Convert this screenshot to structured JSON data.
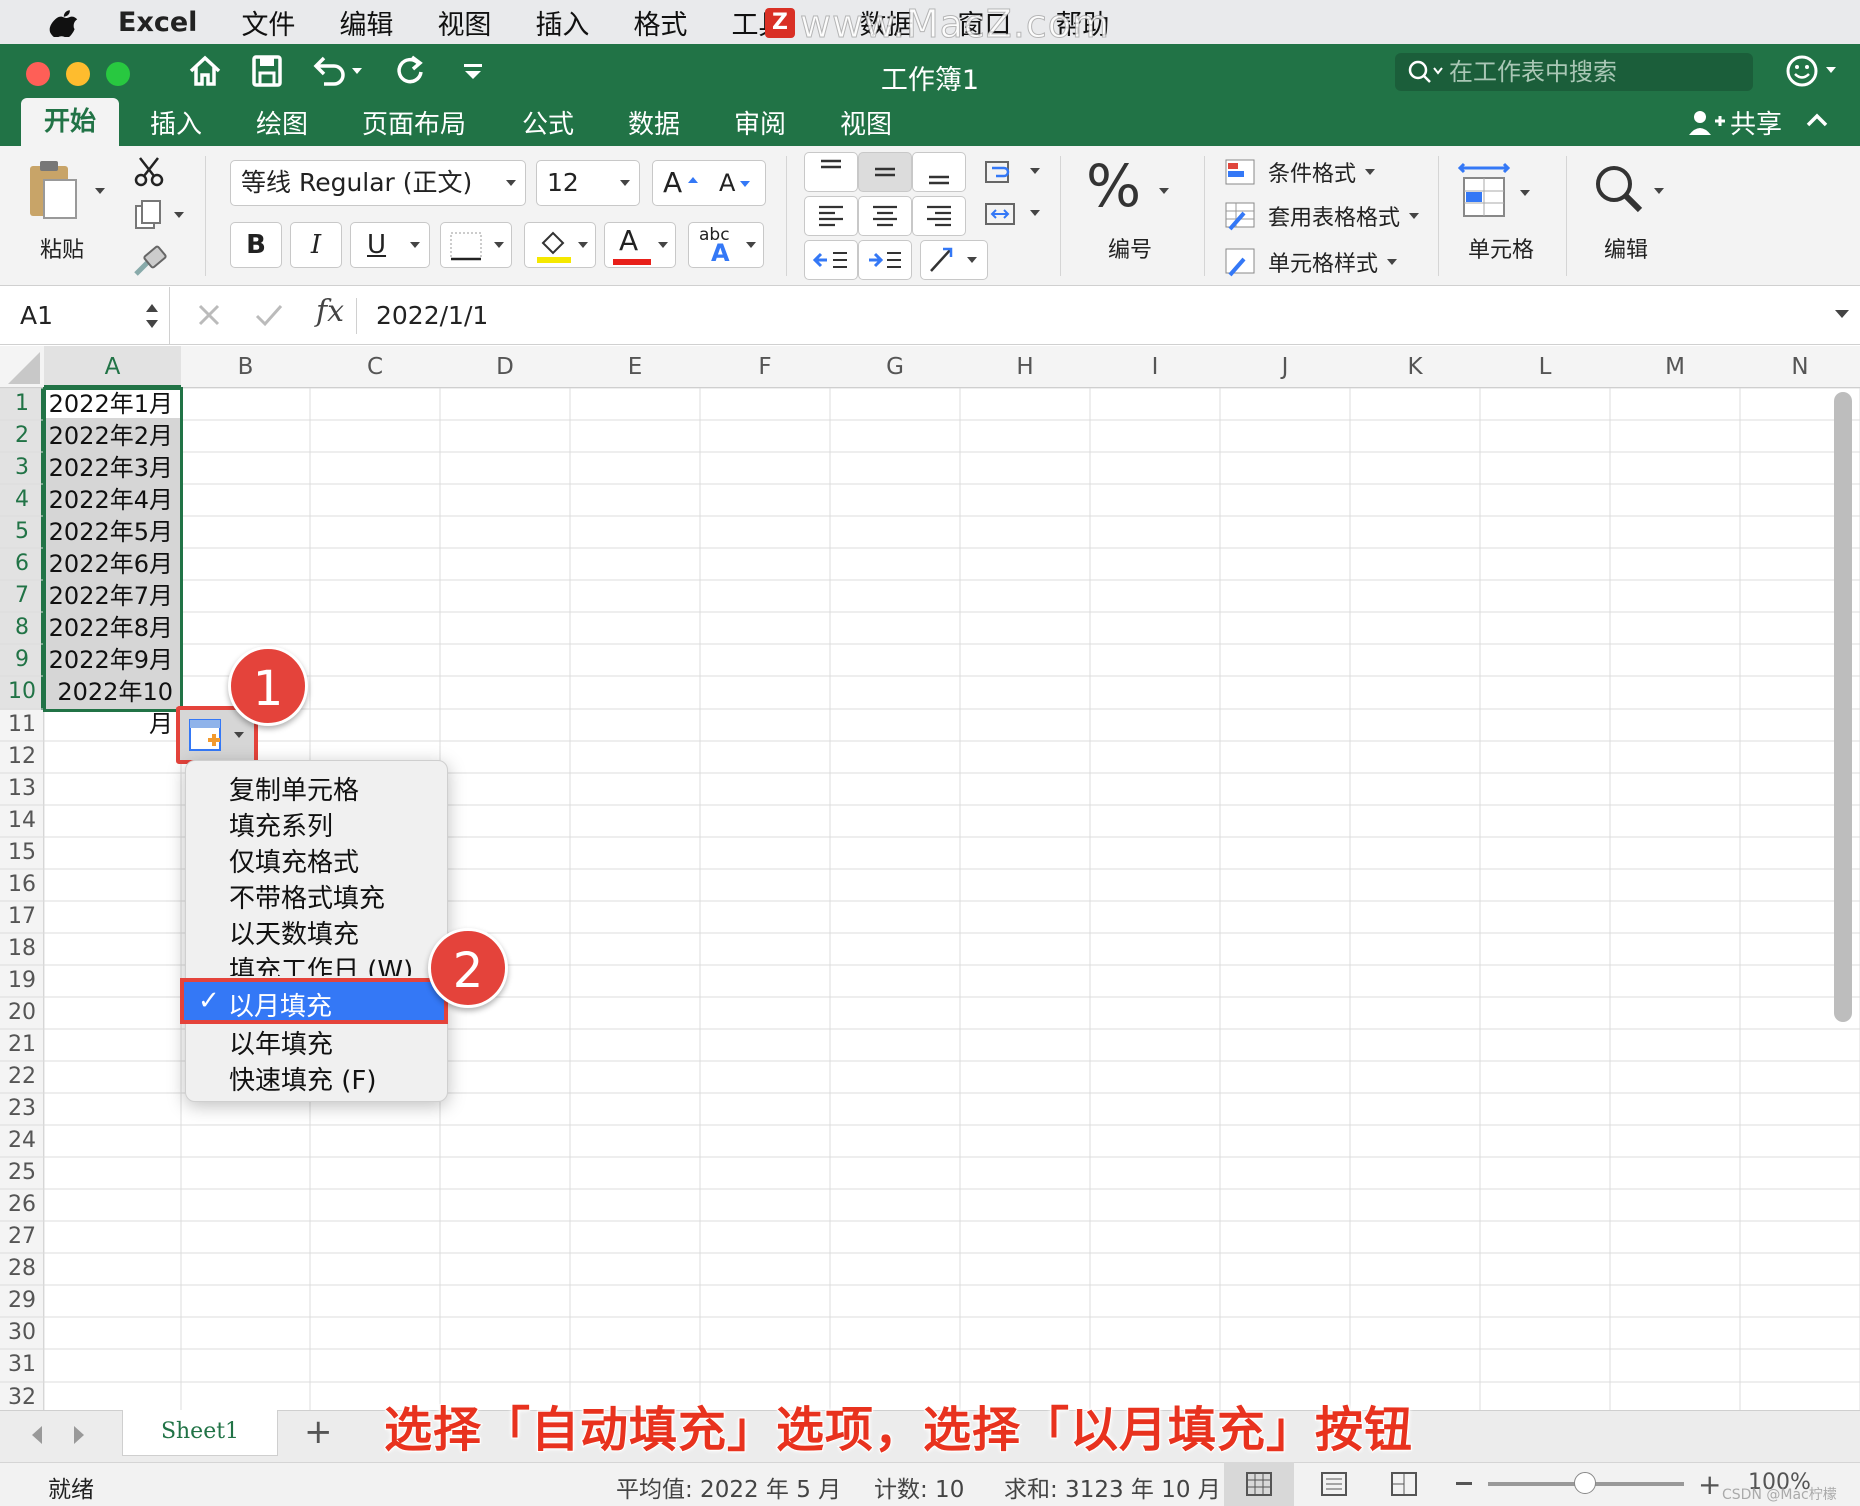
{
  "menubar": {
    "app": "Excel",
    "items": [
      "文件",
      "编辑",
      "视图",
      "插入",
      "格式",
      "工具",
      "数据",
      "窗口",
      "帮助"
    ],
    "watermark": "www.MacZ.com",
    "watermark_logo": "Z"
  },
  "window": {
    "title": "工作簿1",
    "search_placeholder": "在工作表中搜索"
  },
  "ribbon": {
    "tabs": [
      "开始",
      "插入",
      "绘图",
      "页面布局",
      "公式",
      "数据",
      "审阅",
      "视图"
    ],
    "share": "共享",
    "paste_label": "粘贴",
    "font_name": "等线 Regular (正文)",
    "font_size": "12",
    "bold": "B",
    "italic": "I",
    "underline": "U",
    "font_grow": "A",
    "font_shrink": "A",
    "font_color_glyph": "A",
    "abc": "abc",
    "abc_a": "A",
    "number_symbol": "%",
    "number_label": "编号",
    "conditional_format": "条件格式",
    "table_format": "套用表格格式",
    "cell_styles": "单元格样式",
    "cells_label": "单元格",
    "edit_label": "编辑"
  },
  "formula_bar": {
    "cell_ref": "A1",
    "fx": "fx",
    "value": "2022/1/1"
  },
  "grid": {
    "columns": [
      "A",
      "B",
      "C",
      "D",
      "E",
      "F",
      "G",
      "H",
      "I",
      "J",
      "K",
      "L",
      "M",
      "N"
    ],
    "rows": [
      "1",
      "2",
      "3",
      "4",
      "5",
      "6",
      "7",
      "8",
      "9",
      "10",
      "11",
      "12",
      "13",
      "14",
      "15",
      "16",
      "17",
      "18",
      "19",
      "20",
      "21",
      "22",
      "23",
      "24",
      "25",
      "26",
      "27",
      "28",
      "29",
      "30",
      "31",
      "32"
    ],
    "a_values": [
      "2022年1月",
      "2022年2月",
      "2022年3月",
      "2022年4月",
      "2022年5月",
      "2022年6月",
      "2022年7月",
      "2022年8月",
      "2022年9月",
      "2022年10月"
    ]
  },
  "autofill_menu": {
    "items": [
      "复制单元格",
      "填充系列",
      "仅填充格式",
      "不带格式填充",
      "以天数填充",
      "填充工作日 (W)",
      "以月填充",
      "以年填充",
      "快速填充 (F)"
    ],
    "selected": "以月填充",
    "check": "✓"
  },
  "annotations": {
    "badge1": "1",
    "badge2": "2",
    "caption": "选择「自动填充」选项，选择「以月填充」按钮"
  },
  "sheets": {
    "tabs": [
      "Sheet1"
    ],
    "add": "+"
  },
  "status": {
    "ready": "就绪",
    "average": "平均值: 2022 年 5 月",
    "count": "计数: 10",
    "sum": "求和: 3123 年 10 月",
    "zoom": "100%",
    "credit": "CSDN @Mac柠檬"
  },
  "colors": {
    "excel_green": "#217346",
    "highlight_blue": "#3478f6",
    "badge_red": "#e4433b",
    "caption_red": "#e8321e"
  }
}
